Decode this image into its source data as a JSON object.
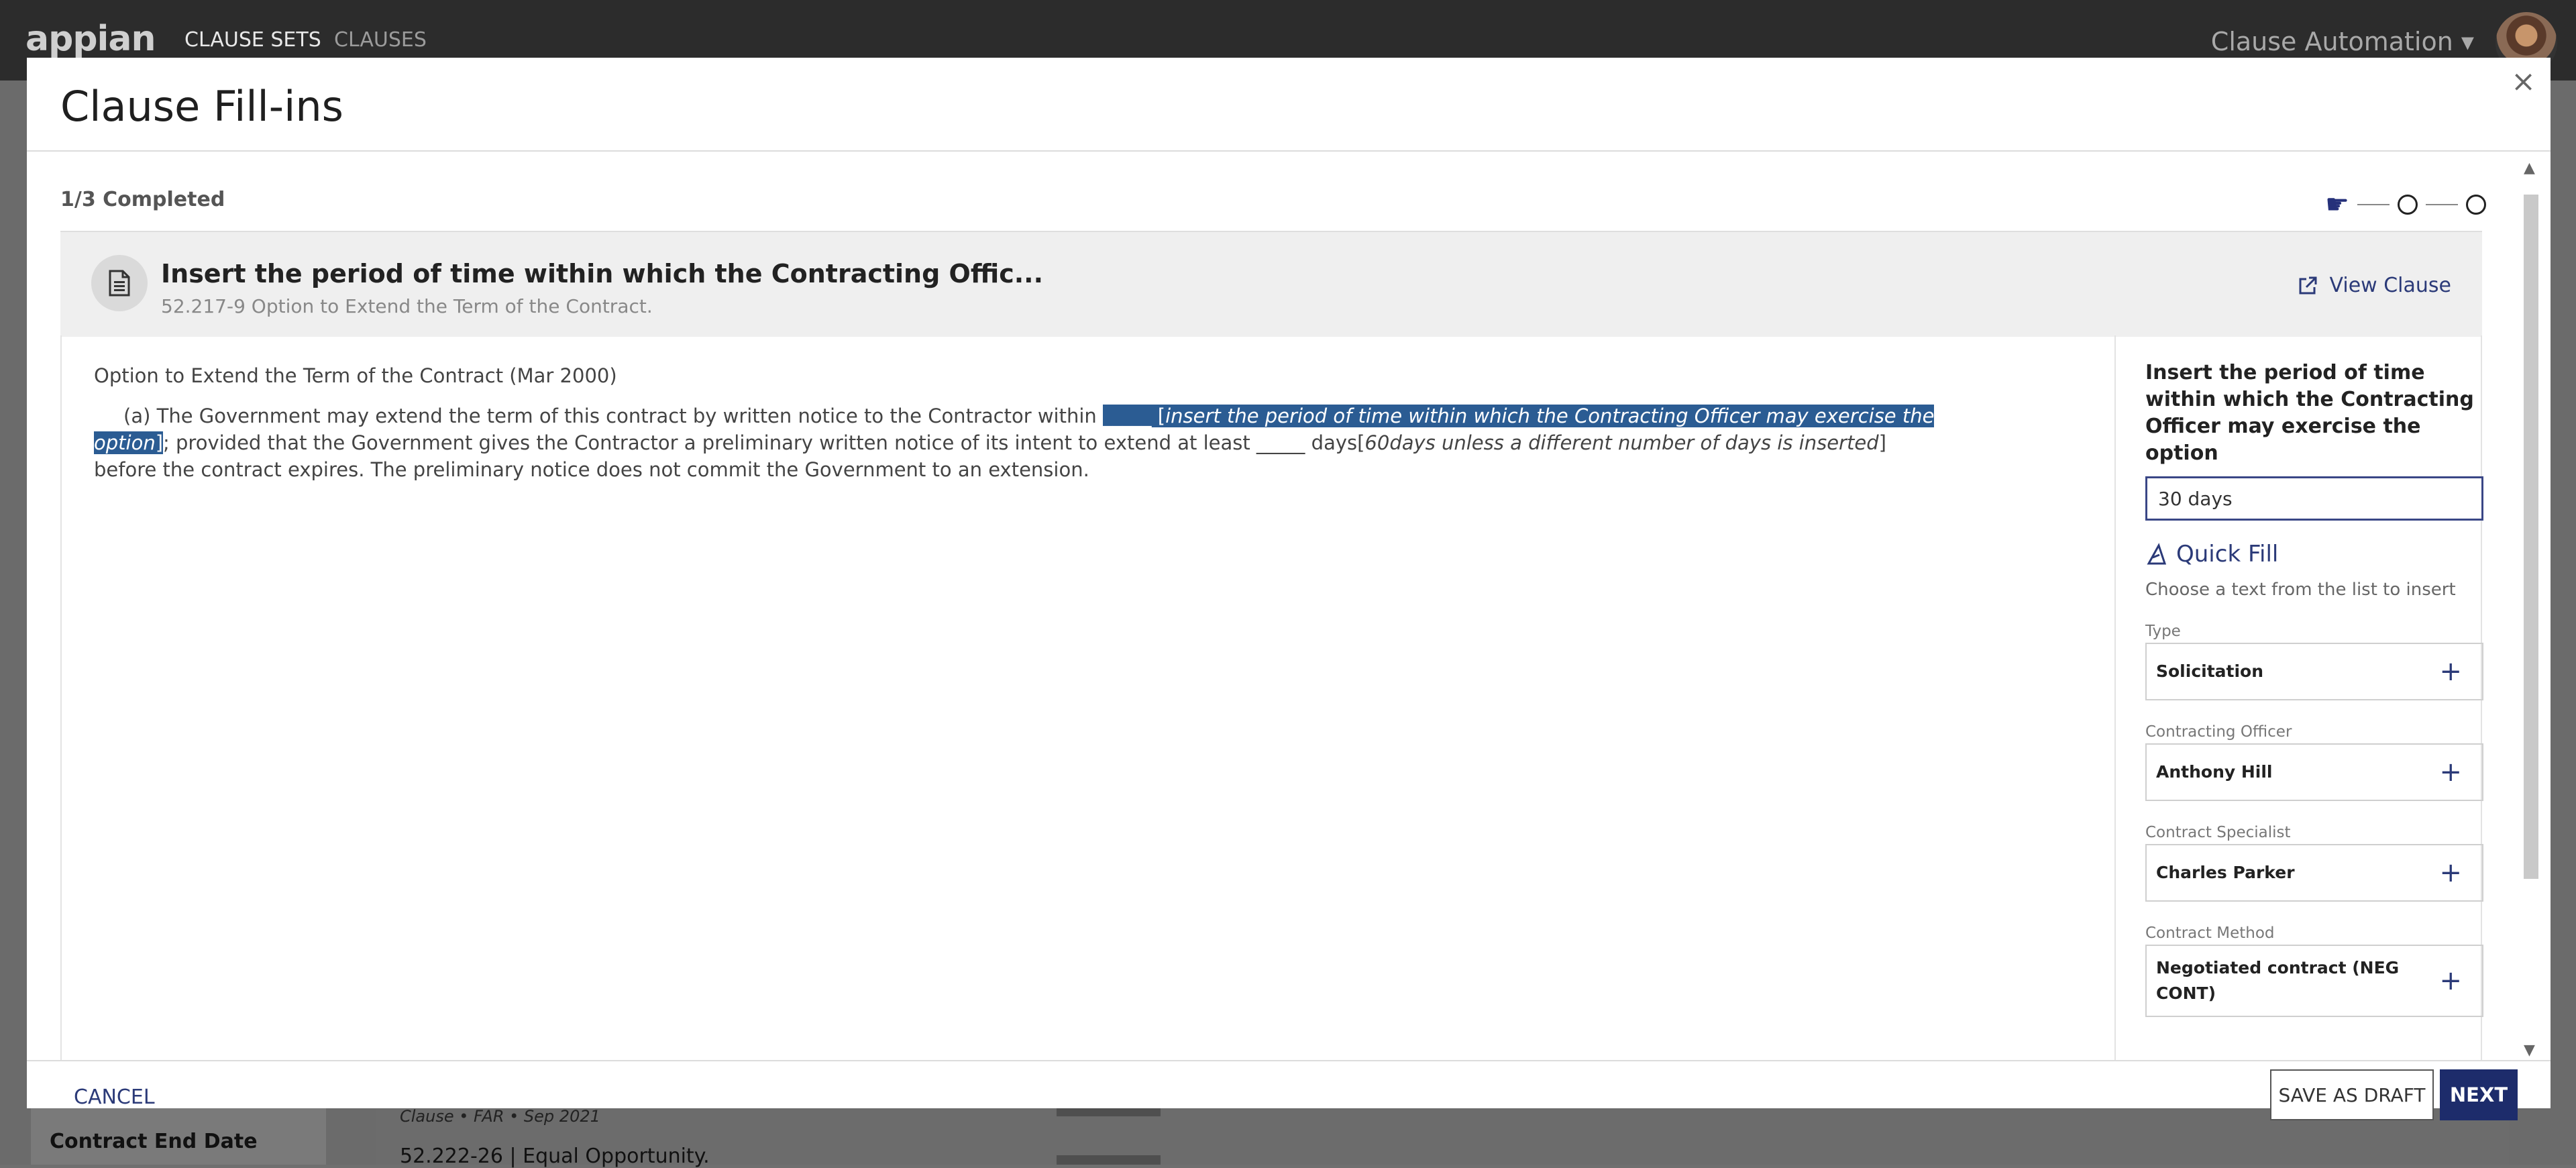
{
  "app": {
    "logo": "appian",
    "nav": [
      "CLAUSE SETS",
      "CLAUSES"
    ],
    "app_name": "Clause Automation",
    "app_name_caret": "▾"
  },
  "background": {
    "side_label": "Contract End Date",
    "row1_meta": "Clause • FAR • Sep 2021",
    "row2_title": "52.222-26 | Equal Opportunity."
  },
  "modal": {
    "title": "Clause Fill-ins",
    "close_icon": "×",
    "progress": "1/3 Completed",
    "clause_title": "Insert the period of time within which the Contracting Offic...",
    "clause_subtitle": "52.217-9 Option to Extend the Term of the Contract.",
    "view_clause": "View Clause",
    "body": {
      "heading": "Option to Extend the Term of the Contract (Mar 2000)",
      "p1": "(a) The Government may extend the term of this contract by written notice to the Contractor within ",
      "blank1": "_____",
      "fillin1_open": " [",
      "fillin1": "insert the period of time within which the Contracting Officer may exercise the option",
      "fillin1_close": "]",
      "p2": "; provided that the Government gives the Contractor a preliminary written notice of its intent to extend at least _____ days[",
      "fillin2": "60days unless a different number of days is inserted",
      "p3": "] before the contract expires. The preliminary notice does not commit the Government to an extension."
    },
    "side": {
      "label": "Insert the period of time within which the Contracting Officer may exercise the option",
      "input_value": "30 days",
      "quick_fill": "Quick Fill",
      "hint": "Choose a text from the list to insert",
      "fields": [
        {
          "label": "Type",
          "value": "Solicitation"
        },
        {
          "label": "Contracting Officer",
          "value": "Anthony Hill"
        },
        {
          "label": "Contract Specialist",
          "value": "Charles Parker"
        },
        {
          "label": "Contract Method",
          "value": "Negotiated contract (NEG CONT)"
        }
      ],
      "plus": "+"
    },
    "footer": {
      "cancel": "CANCEL",
      "save_draft": "SAVE AS DRAFT",
      "next": "NEXT"
    }
  },
  "colors": {
    "accent": "#1d2c6b",
    "highlight": "#2b5c93",
    "topbar": "#2c2c2c"
  }
}
